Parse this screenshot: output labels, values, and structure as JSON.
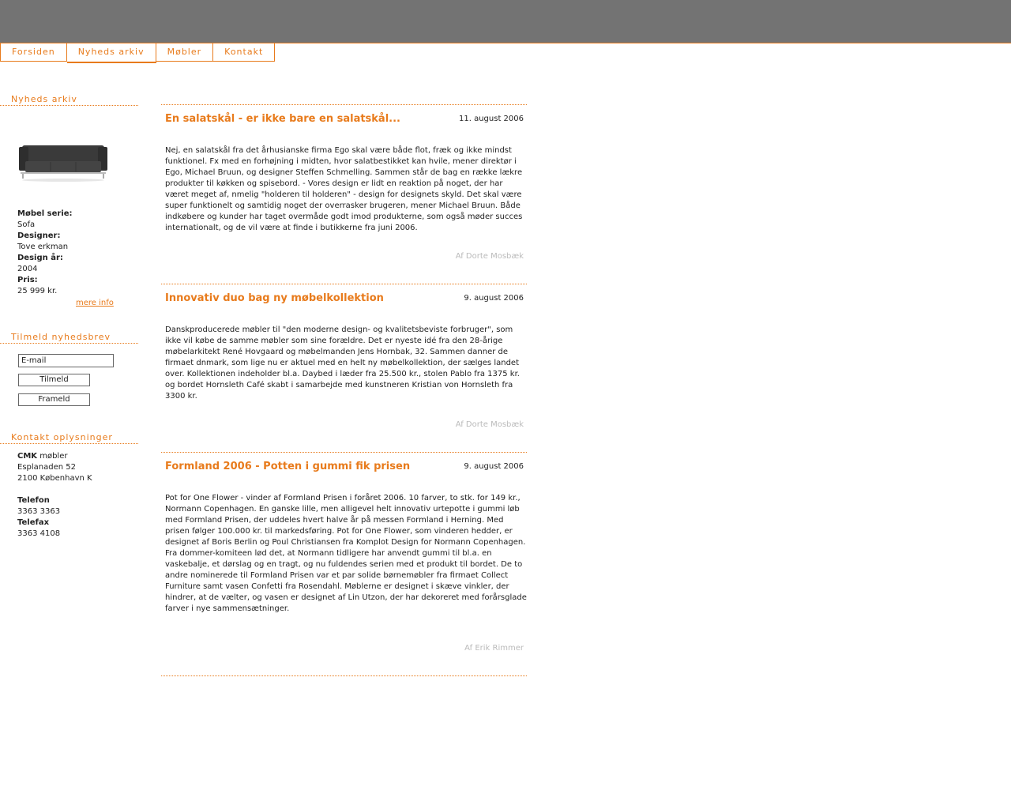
{
  "nav": {
    "tabs": [
      {
        "label": "Forsiden"
      },
      {
        "label": "Nyheds arkiv"
      },
      {
        "label": "Møbler"
      },
      {
        "label": "Kontakt"
      }
    ]
  },
  "sidebar": {
    "archive_heading": "Nyheds arkiv",
    "product": {
      "series_label": "Møbel serie:",
      "series": "Sofa",
      "designer_label": "Designer:",
      "designer": "Tove erkman",
      "year_label": "Design år:",
      "year": "2004",
      "price_label": "Pris:",
      "price": "25 999 kr.",
      "more_link": "mere info"
    },
    "newsletter_heading": "Tilmeld nyhedsbrev",
    "email_value": "E-mail",
    "subscribe_label": "Tilmeld",
    "unsubscribe_label": "Frameld",
    "contact_heading": "Kontakt oplysninger",
    "contact": {
      "company_bold": "CMK",
      "company_rest": " møbler",
      "street": "Esplanaden 52",
      "city": "2100 København K",
      "phone_label": "Telefon",
      "phone": "3363 3363",
      "fax_label": "Telefax",
      "fax": "3363 4108"
    }
  },
  "articles": [
    {
      "title": "En salatskål - er ikke bare en salatskål...",
      "date": "11. august 2006",
      "body": "Nej, en salatskål fra det århusianske firma Ego skal være både flot, fræk og ikke mindst funktionel. Fx med en forhøjning i midten, hvor salatbestikket kan hvile, mener direktør i Ego, Michael Bruun, og designer Steffen Schmelling. Sammen står de bag en række lækre produkter til køkken og spisebord. - Vores design er lidt en reaktion på noget, der har været meget af, nmelig \"holderen til holderen\" - design for designets skyld. Det skal være super funktionelt og samtidig noget der overrasker brugeren, mener Michael Bruun. Både indkøbere og kunder har taget overmåde godt imod produkterne, som også møder succes internationalt, og de vil være at finde i butikkerne fra juni 2006.",
      "author": "Af Dorte Mosbæk"
    },
    {
      "title": "Innovativ duo bag ny møbelkollektion",
      "date": "9. august 2006",
      "body": "Danskproducerede møbler til \"den moderne design- og kvalitetsbeviste forbruger\", som ikke vil købe de samme møbler som sine forældre. Det er nyeste idé fra den 28-årige møbelarkitekt René Hovgaard og møbelmanden Jens Hornbak, 32. Sammen danner de firmaet dnmark, som lige nu er aktuel med en helt ny møbelkollektion, der sælges landet over. Kollektionen indeholder bl.a. Daybed i læder fra 25.500 kr., stolen Pablo fra 1375 kr. og bordet Hornsleth Café skabt i samarbejde med kunstneren Kristian von Hornsleth fra 3300 kr.",
      "author": "Af Dorte Mosbæk"
    },
    {
      "title": "Formland 2006 - Potten i gummi fik prisen",
      "date": "9. august 2006",
      "body": "Pot for One Flower - vinder af Formland Prisen i foråret 2006. 10 farver, to stk. for 149 kr., Normann Copenhagen. En ganske lille, men alligevel helt innovativ urtepotte i gummi løb med Formland Prisen, der uddeles hvert halve år på messen Formland i Herning. Med prisen følger 100.000 kr. til markedsføring. Pot for One Flower, som vinderen hedder, er designet af Boris Berlin og Poul Christiansen fra Komplot Design for Normann Copenhagen. Fra dommer-komiteen lød det, at Normann tidligere har anvendt gummi til bl.a. en vaskebalje, et dørslag og en tragt, og nu fuldendes serien med et produkt til bordet. De to andre nominerede til Formland Prisen var et par solide børnemøbler fra firmaet Collect Furniture samt vasen Confetti fra Rosendahl. Møblerne er designet i skæve vinkler, der hindrer, at de vælter, og vasen er designet af Lin Utzon, der har dekoreret med forårsglade farver i nye sammensætninger.",
      "author": "Af Erik Rimmer"
    }
  ],
  "colors": {
    "accent": "#e87b1c",
    "header": "#737373",
    "author": "#bbbbbb"
  }
}
